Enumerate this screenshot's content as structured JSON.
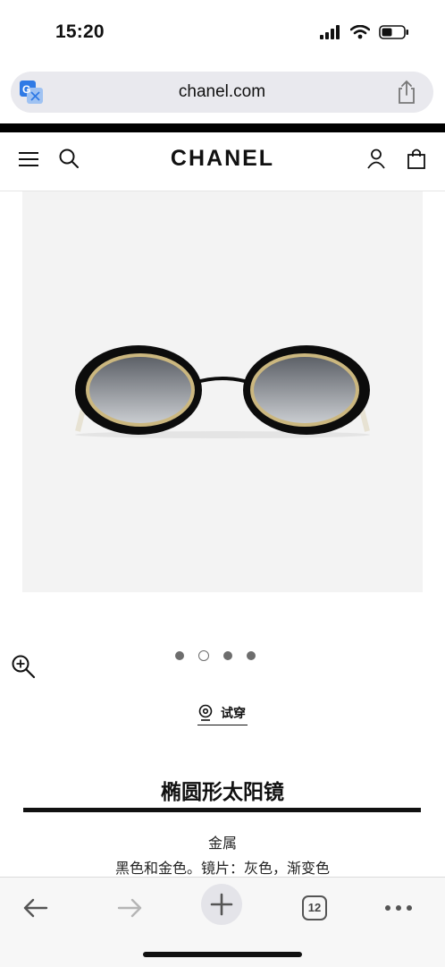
{
  "status_bar": {
    "time": "15:20",
    "icons": [
      "signal-icon",
      "wifi-icon",
      "battery-icon"
    ]
  },
  "browser": {
    "url": "chanel.com",
    "open_tabs": "12"
  },
  "site": {
    "logo": "CHANEL"
  },
  "gallery": {
    "slide_count": 4,
    "active_slide": 2
  },
  "try_on": {
    "label": "试穿"
  },
  "product": {
    "title": "椭圆形太阳镜",
    "material": "金属",
    "description": "黑色和金色。镜片：灰色，渐变色"
  },
  "colors": {
    "accent": "#111111",
    "image_bg": "#f3f3f3",
    "address_bar": "#e9e9ee",
    "translate_blue": "#2f7ae5"
  }
}
